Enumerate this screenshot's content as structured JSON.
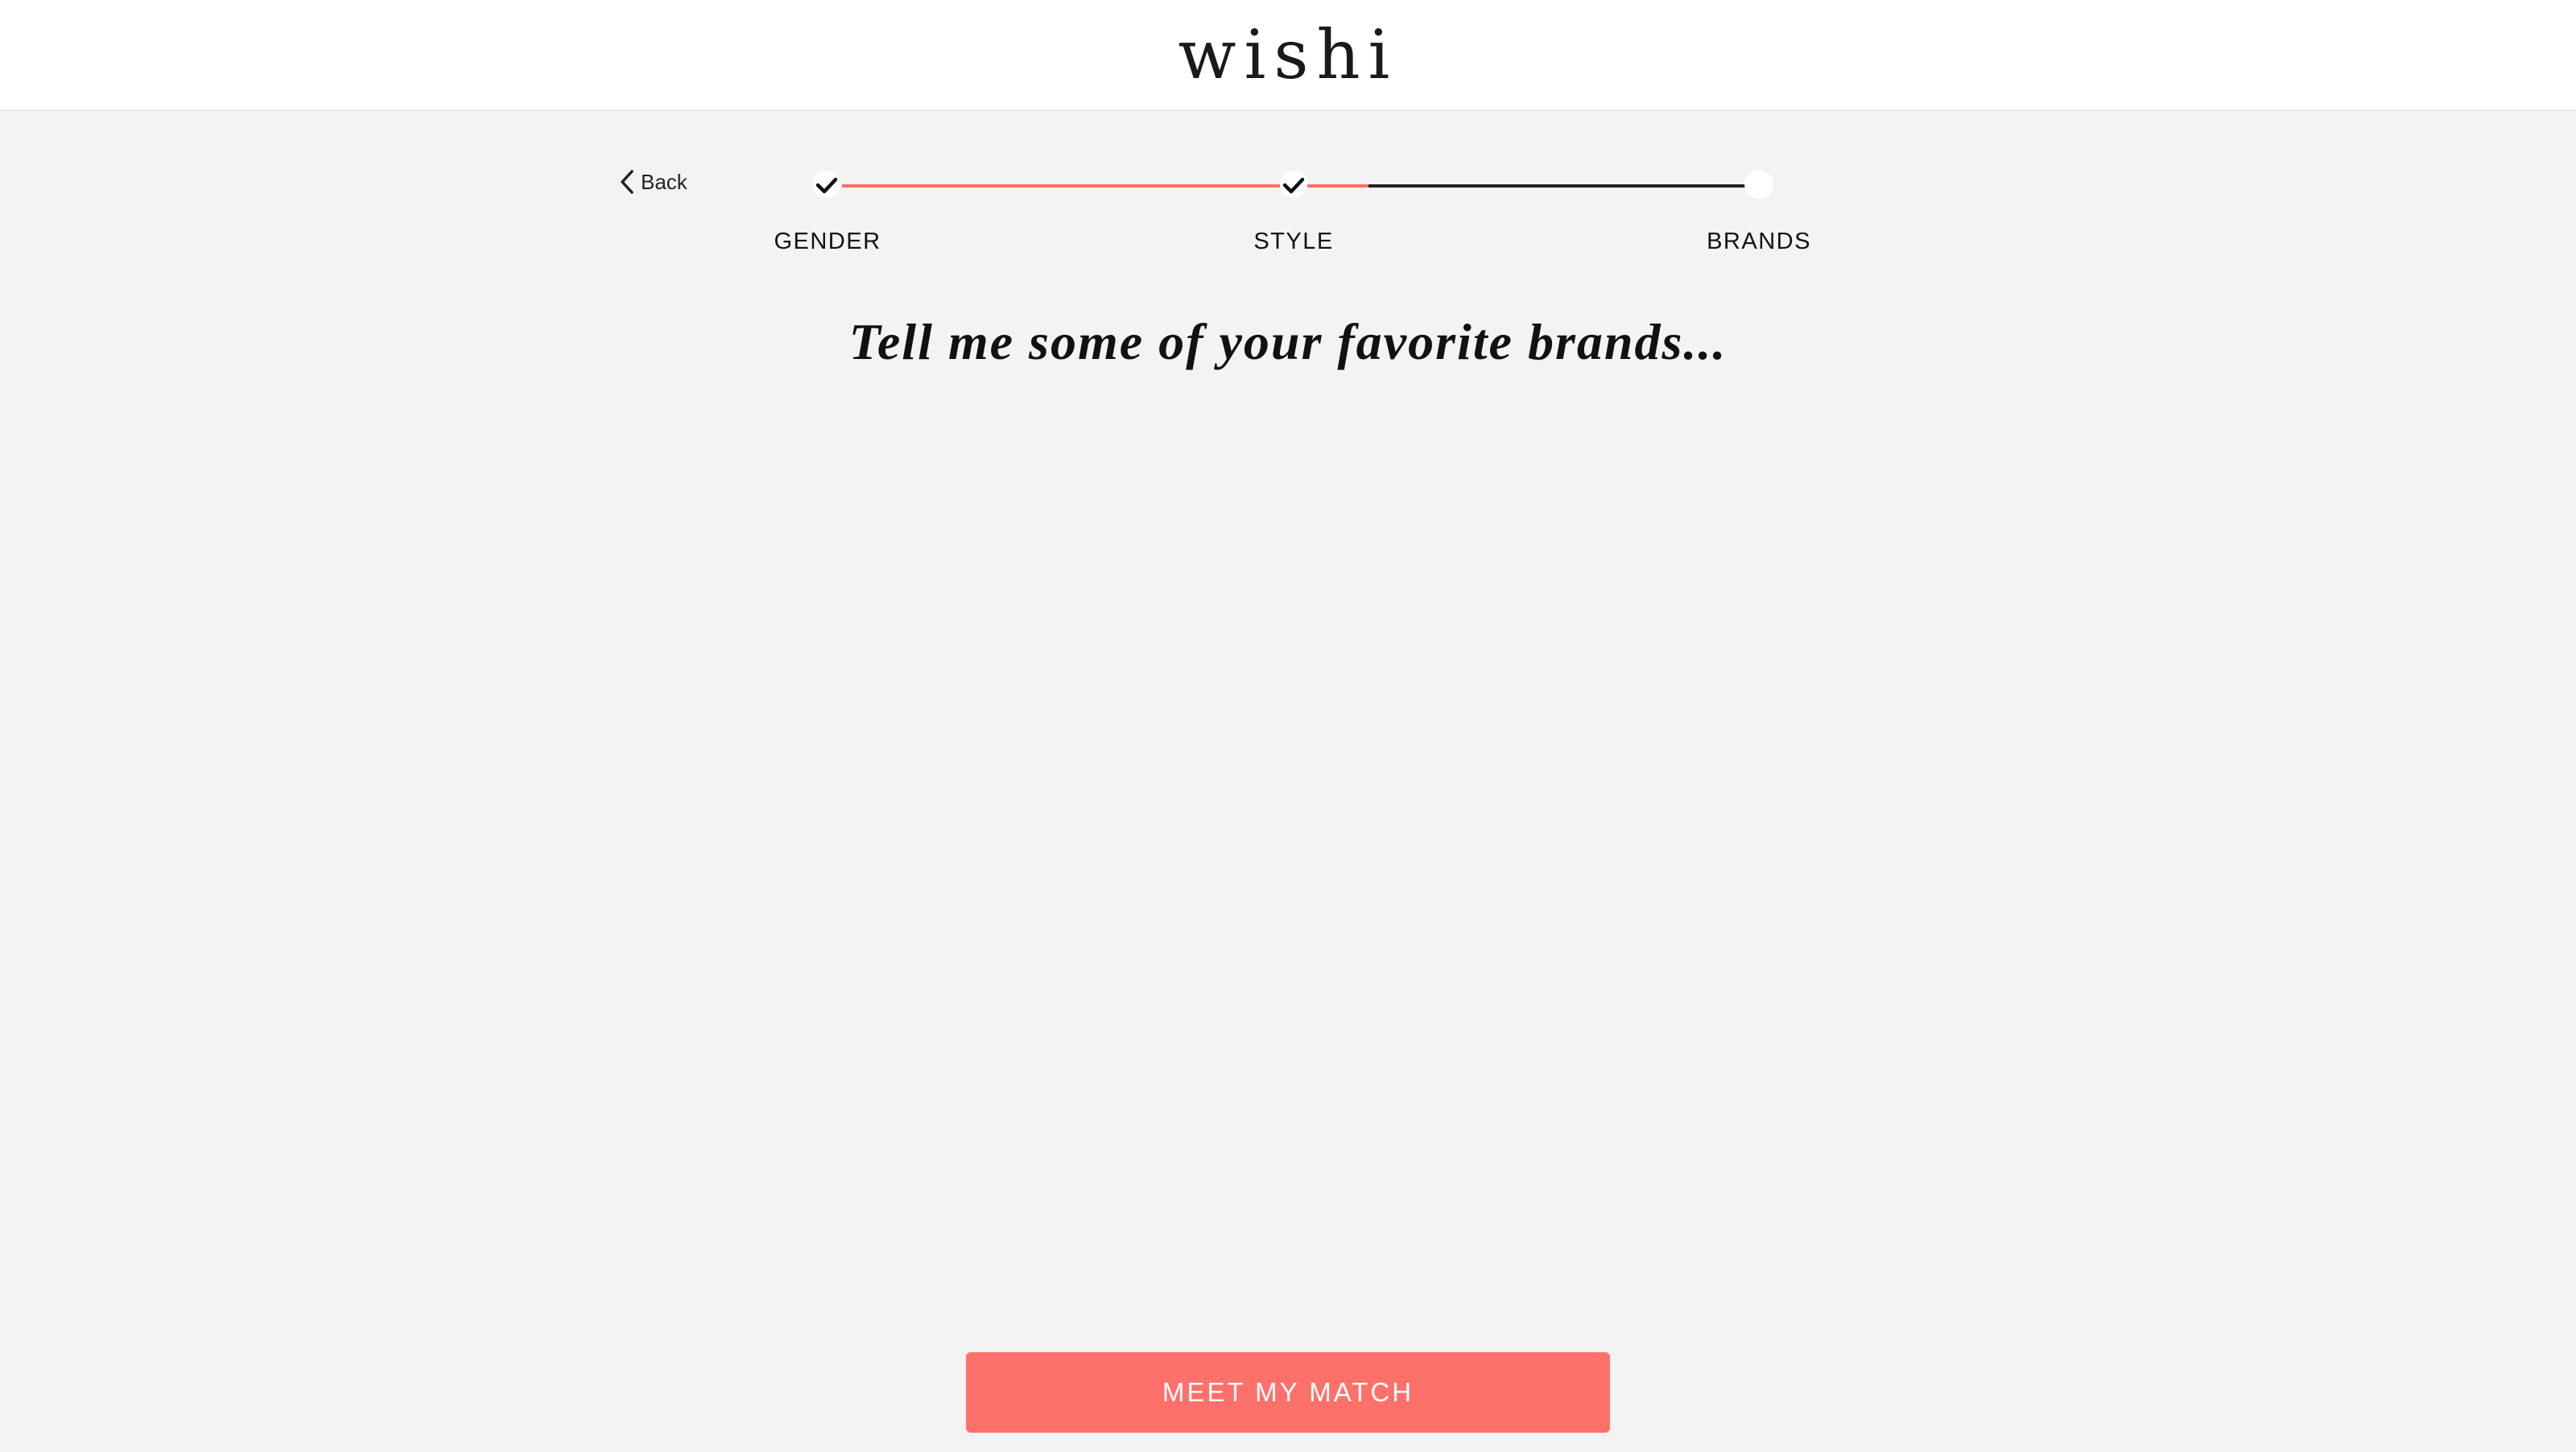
{
  "header": {
    "logo_text": "wishi"
  },
  "nav": {
    "back_label": "Back"
  },
  "progress": {
    "steps": [
      {
        "label": "GENDER",
        "status": "complete"
      },
      {
        "label": "STYLE",
        "status": "complete"
      },
      {
        "label": "BRANDS",
        "status": "current"
      }
    ],
    "completed_color": "#fd716a",
    "pending_color": "#222222"
  },
  "main": {
    "headline": "Tell me some of your favorite brands..."
  },
  "footer": {
    "cta_label": "MEET MY MATCH",
    "cta_color": "#fd716a"
  }
}
